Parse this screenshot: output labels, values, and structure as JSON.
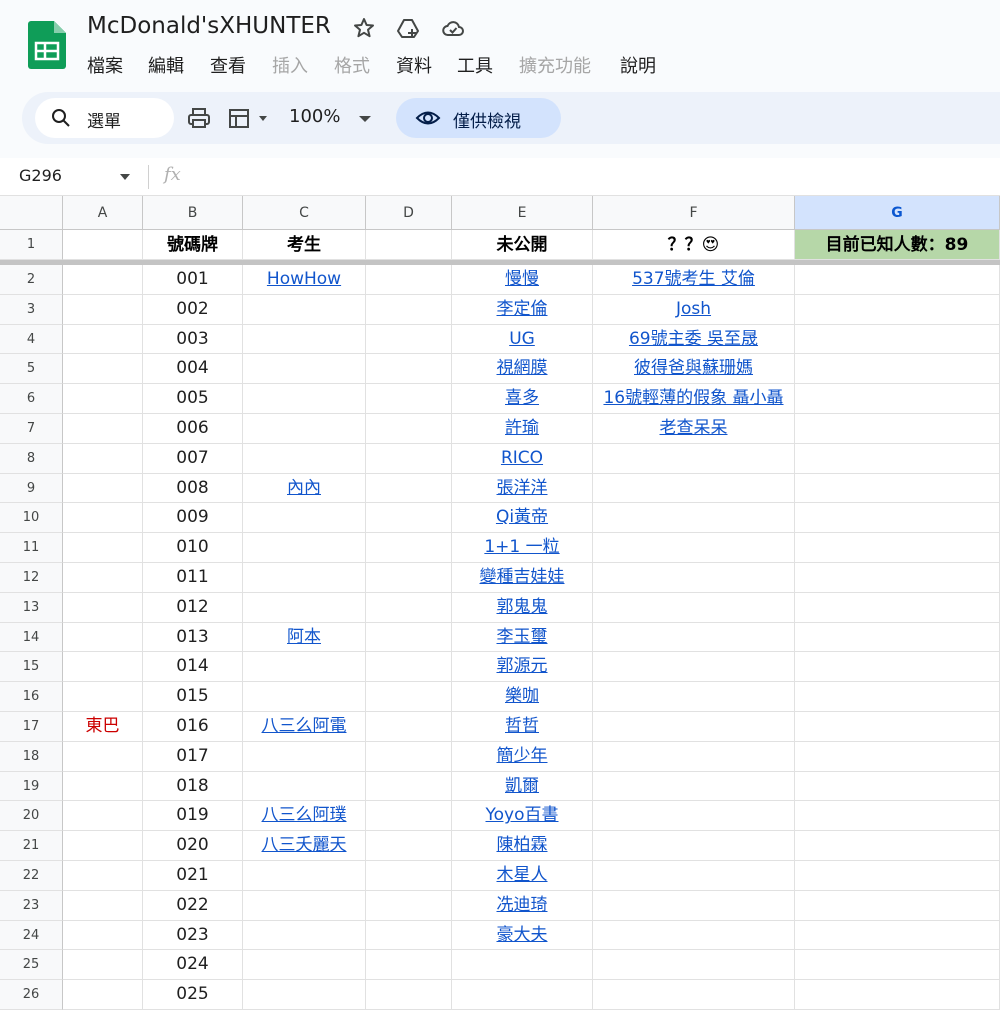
{
  "doc": {
    "title": "McDonald'sXHUNTER",
    "icons": [
      "star-icon",
      "cloud-move-icon",
      "cloud-saved-icon"
    ]
  },
  "menu": [
    "檔案",
    "編輯",
    "查看",
    "插入",
    "格式",
    "資料",
    "工具",
    "擴充功能",
    "說明"
  ],
  "menu_disabled": [
    false,
    false,
    false,
    true,
    true,
    false,
    false,
    true,
    false
  ],
  "toolbar": {
    "search_label": "選單",
    "zoom": "100%",
    "view_mode_label": "僅供檢視"
  },
  "formula_bar": {
    "name_box": "G296",
    "fx": "fx"
  },
  "colors": {
    "link": "#1155cc",
    "header_green": "#b6d7a8",
    "selected_col": "#d3e3fd",
    "red_text": "#cc0000"
  },
  "sheet": {
    "columns": [
      "A",
      "B",
      "C",
      "D",
      "E",
      "F",
      "G"
    ],
    "selected_column": "G",
    "header_row": {
      "row": "1",
      "A": "",
      "B": "號碼牌",
      "C": "考生",
      "D": "",
      "E": "未公開",
      "F": "？？😍",
      "G": "目前已知人數：89"
    },
    "rows": [
      {
        "row": "2",
        "A": "",
        "B": "001",
        "C": "HowHow",
        "D": "",
        "E": "慢慢",
        "F": "537號考生 艾倫"
      },
      {
        "row": "3",
        "A": "",
        "B": "002",
        "C": "",
        "D": "",
        "E": "李定倫",
        "F": "Josh"
      },
      {
        "row": "4",
        "A": "",
        "B": "003",
        "C": "",
        "D": "",
        "E": "UG",
        "F": "69號主委 吳至晟"
      },
      {
        "row": "5",
        "A": "",
        "B": "004",
        "C": "",
        "D": "",
        "E": "視網膜",
        "F": "彼得爸與蘇珊媽"
      },
      {
        "row": "6",
        "A": "",
        "B": "005",
        "C": "",
        "D": "",
        "E": "喜多",
        "F": "16號輕薄的假象 聶小聶"
      },
      {
        "row": "7",
        "A": "",
        "B": "006",
        "C": "",
        "D": "",
        "E": "許瑜",
        "F": "老查呆呆"
      },
      {
        "row": "8",
        "A": "",
        "B": "007",
        "C": "",
        "D": "",
        "E": "RICO",
        "F": ""
      },
      {
        "row": "9",
        "A": "",
        "B": "008",
        "C": "內內",
        "D": "",
        "E": "張洋洋",
        "F": ""
      },
      {
        "row": "10",
        "A": "",
        "B": "009",
        "C": "",
        "D": "",
        "E": "Qi黃帝",
        "F": ""
      },
      {
        "row": "11",
        "A": "",
        "B": "010",
        "C": "",
        "D": "",
        "E": "1+1 一粒",
        "F": ""
      },
      {
        "row": "12",
        "A": "",
        "B": "011",
        "C": "",
        "D": "",
        "E": "變種吉娃娃",
        "F": ""
      },
      {
        "row": "13",
        "A": "",
        "B": "012",
        "C": "",
        "D": "",
        "E": "郭鬼鬼",
        "F": ""
      },
      {
        "row": "14",
        "A": "",
        "B": "013",
        "C": "阿本",
        "D": "",
        "E": "李玉璽",
        "F": ""
      },
      {
        "row": "15",
        "A": "",
        "B": "014",
        "C": "",
        "D": "",
        "E": "郭源元",
        "F": ""
      },
      {
        "row": "16",
        "A": "",
        "B": "015",
        "C": "",
        "D": "",
        "E": "樂咖",
        "F": ""
      },
      {
        "row": "17",
        "A": "東巴",
        "B": "016",
        "C": "八三么阿電",
        "D": "",
        "E": "哲哲",
        "F": ""
      },
      {
        "row": "18",
        "A": "",
        "B": "017",
        "C": "",
        "D": "",
        "E": "簡少年",
        "F": ""
      },
      {
        "row": "19",
        "A": "",
        "B": "018",
        "C": "",
        "D": "",
        "E": "凱爾",
        "F": ""
      },
      {
        "row": "20",
        "A": "",
        "B": "019",
        "C": "八三么阿璞",
        "D": "",
        "E": "Yoyo百書",
        "F": ""
      },
      {
        "row": "21",
        "A": "",
        "B": "020",
        "C": "八三夭麗天",
        "D": "",
        "E": "陳柏霖",
        "F": ""
      },
      {
        "row": "22",
        "A": "",
        "B": "021",
        "C": "",
        "D": "",
        "E": "木星人",
        "F": ""
      },
      {
        "row": "23",
        "A": "",
        "B": "022",
        "C": "",
        "D": "",
        "E": "冼迪琦",
        "F": ""
      },
      {
        "row": "24",
        "A": "",
        "B": "023",
        "C": "",
        "D": "",
        "E": "豪大夫",
        "F": ""
      },
      {
        "row": "25",
        "A": "",
        "B": "024",
        "C": "",
        "D": "",
        "E": "",
        "F": ""
      },
      {
        "row": "26",
        "A": "",
        "B": "025",
        "C": "",
        "D": "",
        "E": "",
        "F": ""
      }
    ]
  }
}
